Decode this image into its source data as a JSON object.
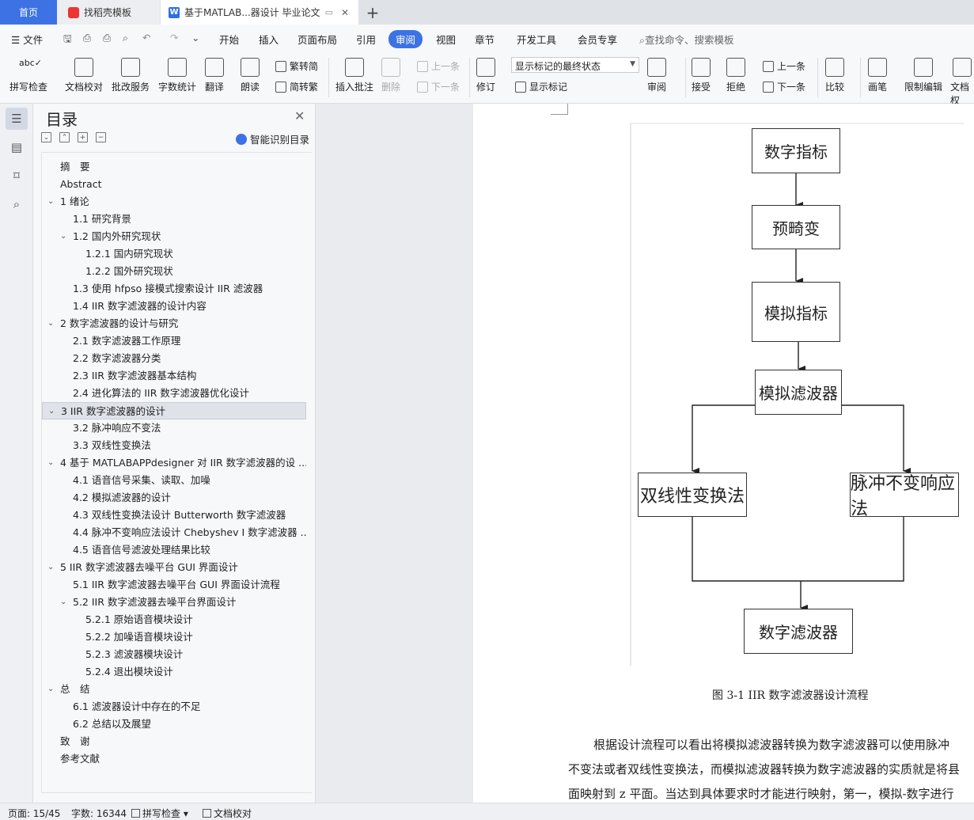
{
  "tabs": {
    "home": "首页",
    "templates": "找稻壳模板",
    "document": "基于MATLAB...器设计 毕业论文"
  },
  "menu": {
    "file": "文件",
    "items": [
      "开始",
      "插入",
      "页面布局",
      "引用",
      "审阅",
      "视图",
      "章节",
      "开发工具",
      "会员专享"
    ],
    "active": "审阅",
    "search": "查找命令、搜索模板"
  },
  "ribbon": {
    "spell_check": "拼写检查",
    "doc_proof": "文档校对",
    "batch_service": "批改服务",
    "word_count": "字数统计",
    "translate": "翻译",
    "read_aloud": "朗读",
    "to_traditional": "繁转简",
    "to_simplified": "简转繁",
    "insert_comment": "插入批注",
    "delete": "删除",
    "prev": "上一条",
    "next": "下一条",
    "revise": "修订",
    "display_state": "显示标记的最终状态",
    "show_marks": "显示标记",
    "review": "审阅",
    "accept": "接受",
    "reject": "拒绝",
    "prev2": "上一条",
    "next2": "下一条",
    "compare": "比较",
    "pen": "画笔",
    "restrict_edit": "限制编辑",
    "doc_perm": "文档权"
  },
  "toc": {
    "title": "目录",
    "smart": "智能识别目录",
    "items": [
      {
        "text": "摘　要",
        "level": 0,
        "arrow": ""
      },
      {
        "text": "Abstract",
        "level": 0,
        "arrow": ""
      },
      {
        "text": "1  绪论",
        "level": 0,
        "arrow": "v"
      },
      {
        "text": "1.1  研究背景",
        "level": 1,
        "arrow": ""
      },
      {
        "text": "1.2  国内外研究现状",
        "level": 1,
        "arrow": "v"
      },
      {
        "text": "1.2.1  国内研究现状",
        "level": 2,
        "arrow": ""
      },
      {
        "text": "1.2.2  国外研究现状",
        "level": 2,
        "arrow": ""
      },
      {
        "text": "1.3  使用 hfpso 接模式搜索设计 IIR 滤波器",
        "level": 1,
        "arrow": ""
      },
      {
        "text": "1.4 IIR 数字滤波器的设计内容",
        "level": 1,
        "arrow": ""
      },
      {
        "text": "2  数字滤波器的设计与研究",
        "level": 0,
        "arrow": "v"
      },
      {
        "text": "2.1  数字滤波器工作原理",
        "level": 1,
        "arrow": ""
      },
      {
        "text": "2.2  数字滤波器分类",
        "level": 1,
        "arrow": ""
      },
      {
        "text": "2.3 IIR 数字滤波器基本结构",
        "level": 1,
        "arrow": ""
      },
      {
        "text": "2.4  进化算法的 IIR 数字滤波器优化设计",
        "level": 1,
        "arrow": ""
      },
      {
        "text": "3 IIR 数字滤波器的设计",
        "level": 0,
        "arrow": "v",
        "selected": true
      },
      {
        "text": "3.2  脉冲响应不变法",
        "level": 1,
        "arrow": ""
      },
      {
        "text": "3.3  双线性变换法",
        "level": 1,
        "arrow": ""
      },
      {
        "text": "4  基于 MATLABAPPdesigner 对 IIR 数字滤波器的设 ...",
        "level": 0,
        "arrow": "v"
      },
      {
        "text": "4.1  语音信号采集、读取、加噪",
        "level": 1,
        "arrow": ""
      },
      {
        "text": "4.2  模拟滤波器的设计",
        "level": 1,
        "arrow": ""
      },
      {
        "text": "4.3  双线性变换法设计 Butterworth 数字滤波器",
        "level": 1,
        "arrow": ""
      },
      {
        "text": "4.4  脉冲不变响应法设计 Chebyshev I 数字滤波器  ...",
        "level": 1,
        "arrow": ""
      },
      {
        "text": "4.5  语音信号滤波处理结果比较",
        "level": 1,
        "arrow": ""
      },
      {
        "text": "5 IIR 数字滤波器去噪平台 GUI 界面设计",
        "level": 0,
        "arrow": "v"
      },
      {
        "text": "5.1 IIR 数字滤波器去噪平台 GUI 界面设计流程",
        "level": 1,
        "arrow": ""
      },
      {
        "text": "5.2 IIR 数字滤波器去噪平台界面设计",
        "level": 1,
        "arrow": "v"
      },
      {
        "text": "5.2.1  原始语音模块设计",
        "level": 2,
        "arrow": ""
      },
      {
        "text": "5.2.2  加噪语音模块设计",
        "level": 2,
        "arrow": ""
      },
      {
        "text": "5.2.3  滤波器模块设计",
        "level": 2,
        "arrow": ""
      },
      {
        "text": "5.2.4  退出模块设计",
        "level": 2,
        "arrow": ""
      },
      {
        "text": "总　结",
        "level": 0,
        "arrow": "v"
      },
      {
        "text": "6.1  滤波器设计中存在的不足",
        "level": 1,
        "arrow": ""
      },
      {
        "text": "6.2  总结以及展望",
        "level": 1,
        "arrow": ""
      },
      {
        "text": "致　谢",
        "level": 0,
        "arrow": ""
      },
      {
        "text": "参考文献",
        "level": 0,
        "arrow": ""
      }
    ]
  },
  "figure": {
    "nodes": {
      "n1": "数字指标",
      "n2": "预畸变",
      "n3": "模拟指标",
      "n4": "模拟滤波器",
      "n5": "双线性变换法",
      "n6": "脉冲不变响应法",
      "n7": "数字滤波器"
    },
    "caption": "图 3-1 IIR 数字滤波器设计流程"
  },
  "body": {
    "line1": "根据设计流程可以看出将模拟滤波器转换为数字滤波器可以使用脉冲",
    "line2": "不变法或者双线性变换法，而模拟滤波器转换为数字滤波器的实质就是将县",
    "line3": "面映射到 z 平面。当达到具体要求时才能进行映射，第一，模拟-数字进行"
  },
  "status": {
    "page": "页面: 15/45",
    "words": "字数: 16344",
    "spell": "拼写检查",
    "proof": "文档校对"
  }
}
